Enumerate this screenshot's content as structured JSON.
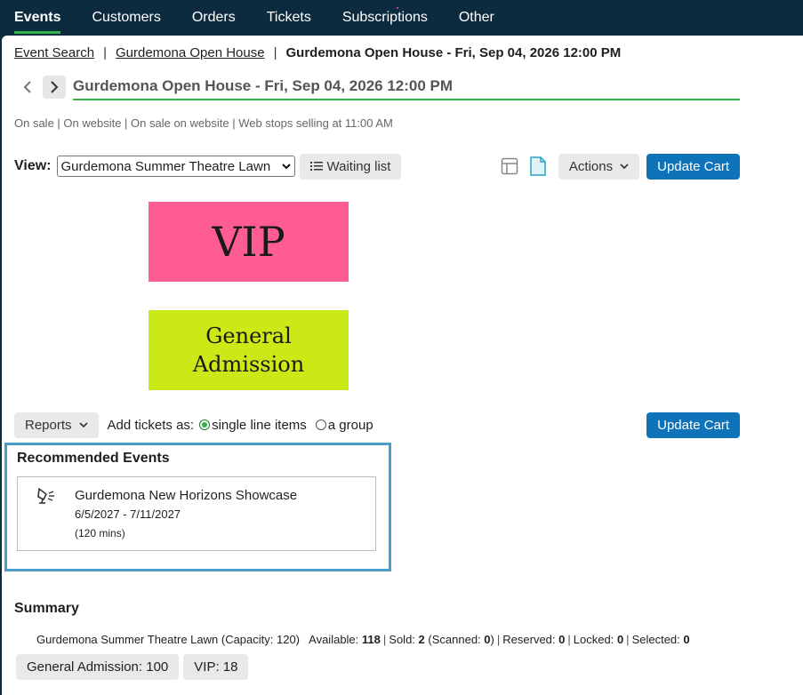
{
  "nav": {
    "items": [
      {
        "label": "Events",
        "active": true
      },
      {
        "label": "Customers",
        "active": false
      },
      {
        "label": "Orders",
        "active": false
      },
      {
        "label": "Tickets",
        "active": false
      },
      {
        "label": "Subscriptions",
        "active": false
      },
      {
        "label": "Other",
        "active": false
      }
    ]
  },
  "breadcrumb": {
    "items": [
      "Event Search",
      "Gurdemona Open House"
    ],
    "separator": "|",
    "current": "Gurdemona Open House - Fri, Sep 04, 2026 12:00 PM"
  },
  "event": {
    "title": "Gurdemona Open House - Fri, Sep 04, 2026 12:00 PM",
    "status": "On sale | On website | On sale on website | Web stops selling at 11:00 AM"
  },
  "view": {
    "label": "View:",
    "selected": "Gurdemona Summer Theatre Lawn",
    "waiting_list": "Waiting list",
    "actions": "Actions",
    "update_cart": "Update Cart"
  },
  "seating": {
    "vip": "VIP",
    "ga_line1": "General",
    "ga_line2": "Admission"
  },
  "tickets_opts": {
    "reports": "Reports",
    "add_as": "Add tickets as:",
    "option_single": "single line items",
    "option_group": "a group",
    "update_cart": "Update Cart"
  },
  "recommended": {
    "title": "Recommended Events",
    "items": [
      {
        "name": "Gurdemona New Horizons Showcase",
        "dates": "6/5/2027 - 7/11/2027",
        "duration": "(120 mins)"
      }
    ]
  },
  "summary": {
    "title": "Summary",
    "venue": "Gurdemona Summer Theatre Lawn (Capacity: 120)",
    "available_label": "Available:",
    "available": "118",
    "sold_label": "Sold:",
    "sold": "2",
    "scanned_label": "(Scanned:",
    "scanned": "0",
    "scanned_close": ")",
    "reserved_label": "Reserved:",
    "reserved": "0",
    "locked_label": "Locked:",
    "locked": "0",
    "selected_label": "Selected:",
    "selected": "0",
    "chips": [
      "General Admission: 100",
      "VIP: 18"
    ]
  },
  "colors": {
    "nav_bg": "#0d2b3e",
    "accent_green": "#2fb34a",
    "button_blue": "#0e73b8",
    "vip": "#ff5c93",
    "ga": "#cbe817",
    "highlight": "#4a9cc9"
  }
}
